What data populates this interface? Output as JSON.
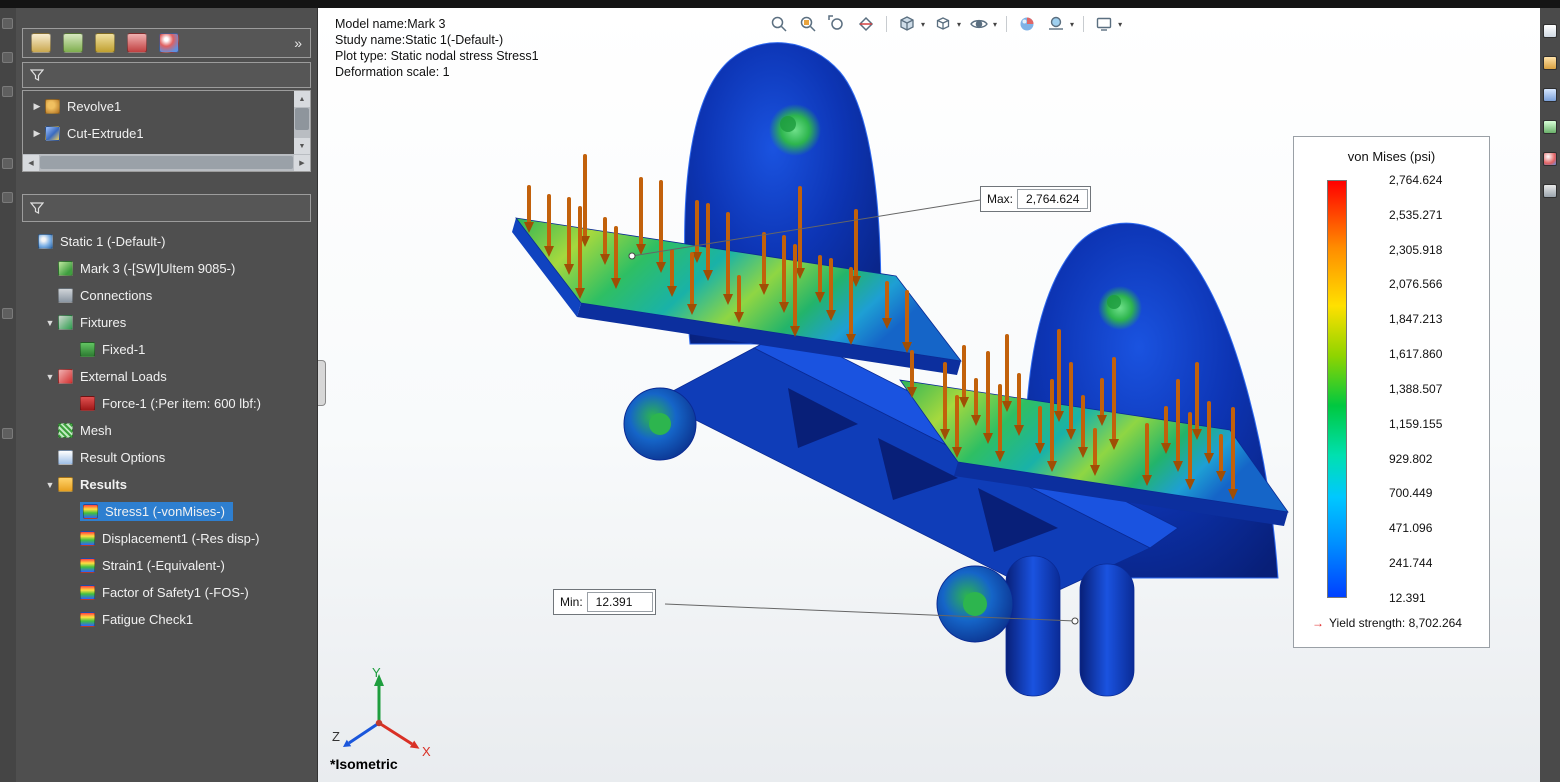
{
  "icons": {
    "collapsed": "▶",
    "expanded": "▼",
    "chevron_more": "»",
    "caret_down": "▾",
    "scroll_up": "▲",
    "scroll_down": "▼",
    "scroll_left": "◀",
    "scroll_right": "▶",
    "yield_arrow": "→"
  },
  "sidebar": {
    "feature_tree": [
      {
        "label": "Revolve1"
      },
      {
        "label": "Cut-Extrude1"
      }
    ],
    "study_tree": [
      {
        "label": "Static 1 (-Default-)"
      },
      {
        "label": "Mark 3 (-[SW]Ultem 9085-)"
      },
      {
        "label": "Connections"
      },
      {
        "label": "Fixtures"
      },
      {
        "label": "Fixed-1"
      },
      {
        "label": "External Loads"
      },
      {
        "label": "Force-1 (:Per item: 600 lbf:)"
      },
      {
        "label": "Mesh"
      },
      {
        "label": "Result Options"
      },
      {
        "label": "Results"
      },
      {
        "label": "Stress1 (-vonMises-)"
      },
      {
        "label": "Displacement1 (-Res disp-)"
      },
      {
        "label": "Strain1 (-Equivalent-)"
      },
      {
        "label": "Factor of Safety1 (-FOS-)"
      },
      {
        "label": "Fatigue Check1"
      }
    ]
  },
  "viewport": {
    "info_lines": {
      "model": "Model name:Mark 3",
      "study": "Study name:Static 1(-Default-)",
      "plot": "Plot type: Static nodal stress Stress1",
      "deformation": "Deformation scale: 1"
    },
    "max_callout": {
      "label": "Max:",
      "value": "2,764.624"
    },
    "min_callout": {
      "label": "Min:",
      "value": "12.391"
    },
    "view_orientation_label": "*Isometric",
    "triad": {
      "x": "X",
      "y": "Y",
      "z": "Z"
    }
  },
  "legend": {
    "title": "von Mises (psi)",
    "values": [
      "2,764.624",
      "2,535.271",
      "2,305.918",
      "2,076.566",
      "1,847.213",
      "1,617.860",
      "1,388.507",
      "1,159.155",
      "929.802",
      "700.449",
      "471.096",
      "241.744",
      "12.391"
    ],
    "yield_label": "Yield strength: 8,702.264",
    "colors": {
      "max": "#ff0000",
      "min": "#0040ff"
    }
  }
}
